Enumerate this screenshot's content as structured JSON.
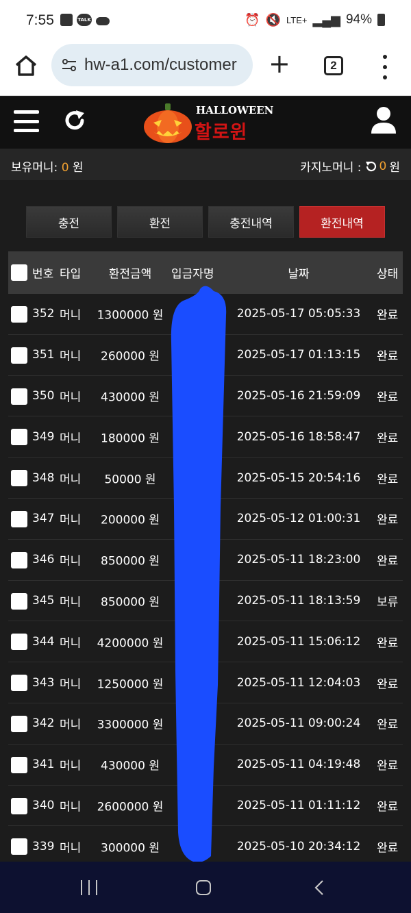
{
  "status_bar": {
    "time": "7:55",
    "talk_label": "TALK",
    "network": "LTE+",
    "battery": "94%"
  },
  "browser": {
    "url": "hw-a1.com/customer",
    "tab_count": "2"
  },
  "site": {
    "logo_top": "HALLOWEEN",
    "logo_main": "할로윈"
  },
  "balance": {
    "holding_label": "보유머니: ",
    "holding_value": "0",
    "holding_unit": " 원",
    "casino_label": "카지노머니 : ",
    "casino_value": "0",
    "casino_unit": " 원"
  },
  "tabs": [
    {
      "label": "충전",
      "active": false
    },
    {
      "label": "환전",
      "active": false
    },
    {
      "label": "충전내역",
      "active": false
    },
    {
      "label": "환전내역",
      "active": true
    }
  ],
  "table": {
    "headers": {
      "number": "번호",
      "type": "타입",
      "amount": "환전금액",
      "depositor": "입금자명",
      "date": "날짜",
      "status": "상태"
    },
    "rows": [
      {
        "number": "352",
        "type": "머니",
        "amount": "1300000 원",
        "date": "2025-05-17 05:05:33",
        "status": "완료"
      },
      {
        "number": "351",
        "type": "머니",
        "amount": "260000 원",
        "date": "2025-05-17 01:13:15",
        "status": "완료"
      },
      {
        "number": "350",
        "type": "머니",
        "amount": "430000 원",
        "date": "2025-05-16 21:59:09",
        "status": "완료"
      },
      {
        "number": "349",
        "type": "머니",
        "amount": "180000 원",
        "date": "2025-05-16 18:58:47",
        "status": "완료"
      },
      {
        "number": "348",
        "type": "머니",
        "amount": "50000 원",
        "date": "2025-05-15 20:54:16",
        "status": "완료"
      },
      {
        "number": "347",
        "type": "머니",
        "amount": "200000 원",
        "date": "2025-05-12 01:00:31",
        "status": "완료"
      },
      {
        "number": "346",
        "type": "머니",
        "amount": "850000 원",
        "date": "2025-05-11 18:23:00",
        "status": "완료"
      },
      {
        "number": "345",
        "type": "머니",
        "amount": "850000 원",
        "date": "2025-05-11 18:13:59",
        "status": "보류"
      },
      {
        "number": "344",
        "type": "머니",
        "amount": "4200000 원",
        "date": "2025-05-11 15:06:12",
        "status": "완료"
      },
      {
        "number": "343",
        "type": "머니",
        "amount": "1250000 원",
        "date": "2025-05-11 12:04:03",
        "status": "완료"
      },
      {
        "number": "342",
        "type": "머니",
        "amount": "3300000 원",
        "date": "2025-05-11 09:00:24",
        "status": "완료"
      },
      {
        "number": "341",
        "type": "머니",
        "amount": "430000 원",
        "date": "2025-05-11 04:19:48",
        "status": "완료"
      },
      {
        "number": "340",
        "type": "머니",
        "amount": "2600000 원",
        "date": "2025-05-11 01:11:12",
        "status": "완료"
      },
      {
        "number": "339",
        "type": "머니",
        "amount": "300000 원",
        "date": "2025-05-10 20:34:12",
        "status": "완료"
      }
    ]
  },
  "colors": {
    "accent_orange": "#f0a030",
    "active_tab": "#b52222",
    "redaction": "#1a4dff",
    "nav_bg": "#0d1130"
  },
  "icons": {
    "home": "home-icon",
    "tune": "tune-icon",
    "add_tab": "plus-icon",
    "menu": "hamburger-icon",
    "refresh": "refresh-icon",
    "user": "user-icon",
    "reload_casino": "reload-icon"
  }
}
